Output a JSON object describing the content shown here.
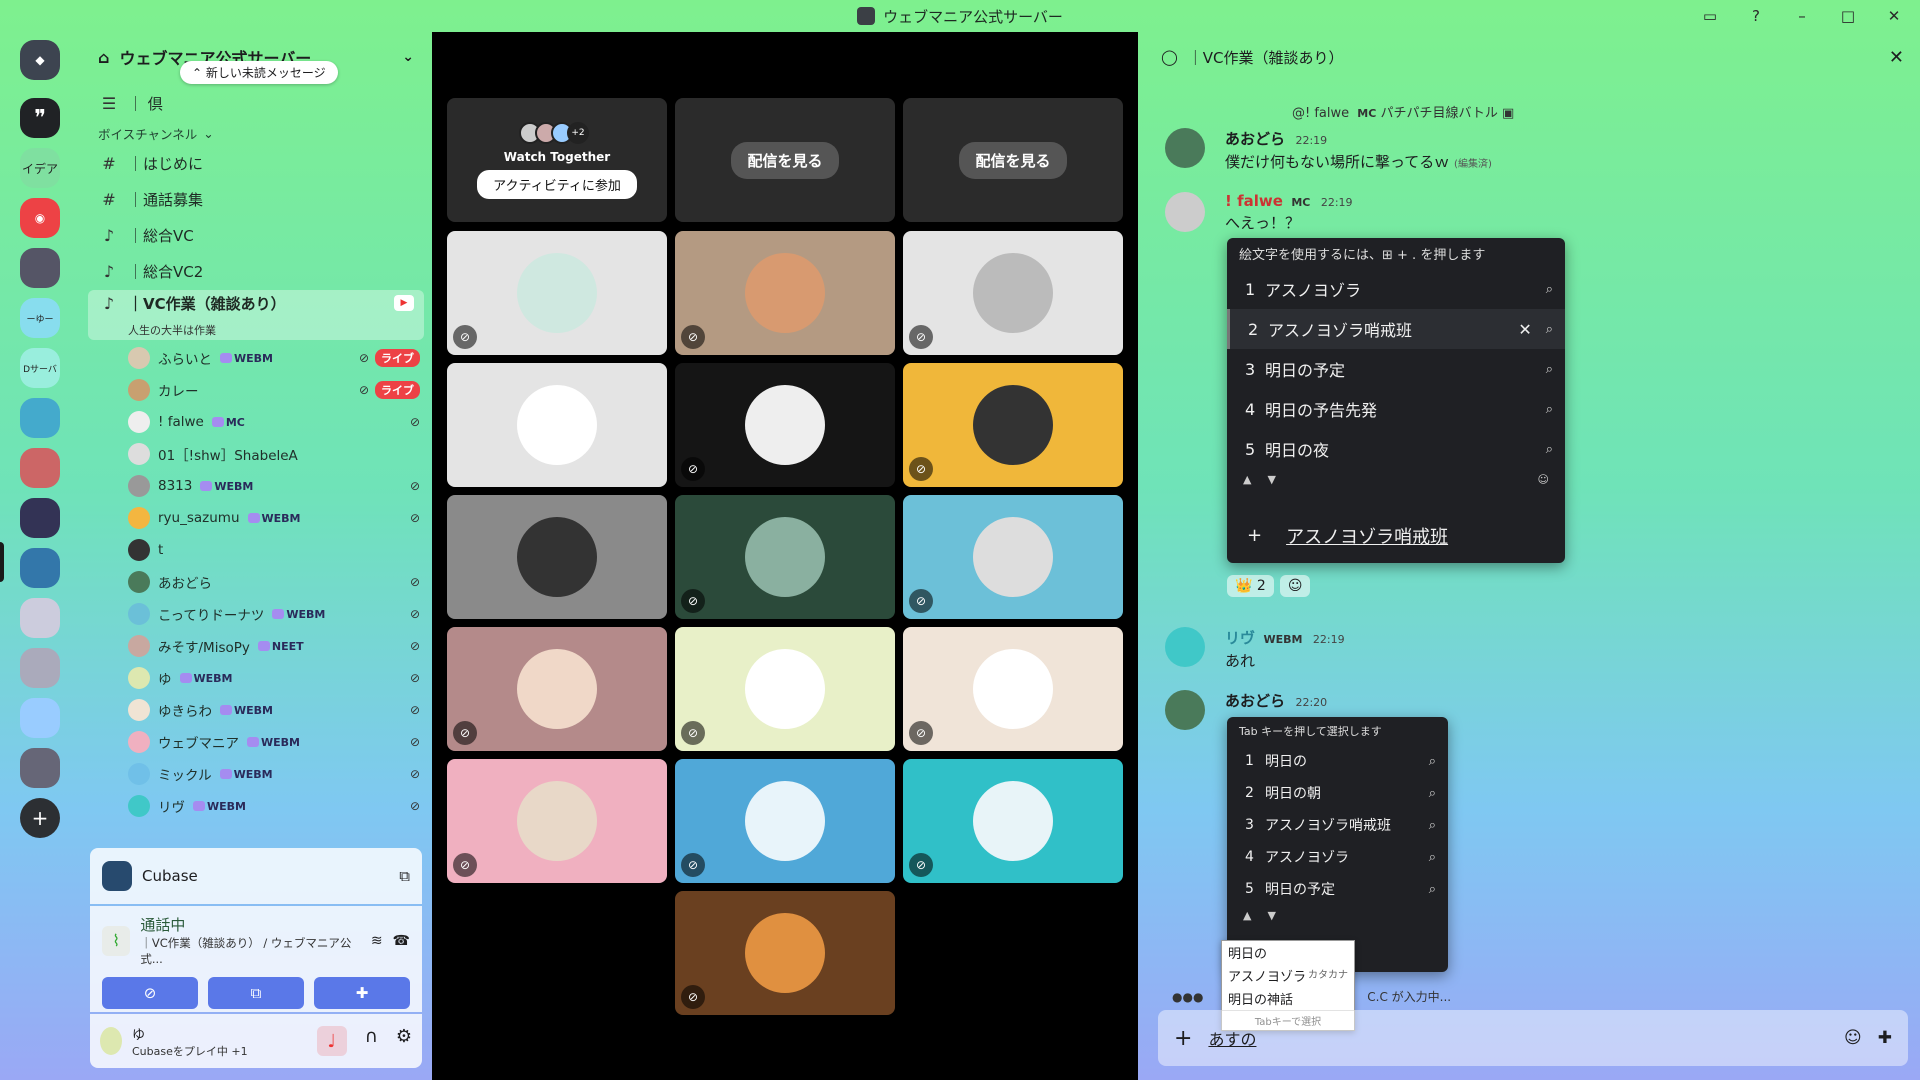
{
  "window": {
    "title": "ウェブマニア公式サーバー"
  },
  "server": {
    "name": "ウェブマニア公式サーバー"
  },
  "sidebar": {
    "unread_pill": "新しい未読メッセージ",
    "category": "ボイスチャンネル",
    "channels": [
      {
        "label": "｜はじめに",
        "icon": "#"
      },
      {
        "label": "｜通話募集",
        "icon": "#"
      },
      {
        "label": "｜総合VC",
        "icon": "🔊"
      },
      {
        "label": "｜総合VC2",
        "icon": "🔊"
      }
    ],
    "active_channel": {
      "label": "｜VC作業（雑談あり）",
      "topic": "人生の大半は作業"
    },
    "voice_users": [
      {
        "name": "ふらいと",
        "tag": "WEBM",
        "live": "ライブ",
        "color": "#d8c9b0"
      },
      {
        "name": "カレー",
        "tag": "",
        "live": "ライブ",
        "color": "#c8a070"
      },
      {
        "name": "! falwe",
        "tag": "MC",
        "live": "",
        "color": "#eee"
      },
      {
        "name": "01［!shw］ShabeleA",
        "tag": "",
        "live": "",
        "color": "#ddd"
      },
      {
        "name": "8313",
        "tag": "WEBM",
        "live": "",
        "color": "#999"
      },
      {
        "name": "ryu_sazumu",
        "tag": "WEBM",
        "live": "",
        "color": "#f3b640"
      },
      {
        "name": "t",
        "tag": "",
        "live": "",
        "color": "#333"
      },
      {
        "name": "あおどら",
        "tag": "",
        "live": "",
        "color": "#4a7a5a"
      },
      {
        "name": "こってりドーナツ",
        "tag": "WEBM",
        "live": "",
        "color": "#6bc0d8"
      },
      {
        "name": "みそす/MisoPy",
        "tag": "NEET",
        "live": "",
        "color": "#c8a8a0"
      },
      {
        "name": "ゆ",
        "tag": "WEBM",
        "live": "",
        "color": "#dde8b0"
      },
      {
        "name": "ゆきらわ",
        "tag": "WEBM",
        "live": "",
        "color": "#f0e4d4"
      },
      {
        "name": "ウェブマニア",
        "tag": "WEBM",
        "live": "",
        "color": "#f0b0c0"
      },
      {
        "name": "ミックル",
        "tag": "WEBM",
        "live": "",
        "color": "#70c0e8"
      },
      {
        "name": "リヴ",
        "tag": "WEBM",
        "live": "",
        "color": "#40c8c8"
      }
    ]
  },
  "activity": {
    "app": "Cubase"
  },
  "voice_status": {
    "state": "通話中",
    "location": "｜VC作業（雑談あり） / ウェブマニア公式..."
  },
  "user": {
    "name": "ゆ",
    "status": "Cubaseをプレイ中 +1"
  },
  "videos": {
    "watch_together": "Watch Together",
    "watch_more": "+2",
    "join_activity": "アクティビティに参加",
    "watch_stream": "配信を見る",
    "watch_stream2": "配信を見る"
  },
  "chat": {
    "channel": "｜VC作業（雑談あり）",
    "reply_preview": "@! falwe",
    "reply_role": "MC",
    "reply_text": "パチパチ目線バトル",
    "messages": [
      {
        "author": "あおどら",
        "time": "22:19",
        "text": "僕だけ何もない場所に撃ってるｗ",
        "edited": "(編集済)"
      },
      {
        "author": "! falwe",
        "role": "MC",
        "time": "22:19",
        "text": "へえっ！？"
      },
      {
        "author": "リヴ",
        "role": "WEBM",
        "time": "22:19",
        "text": "あれ"
      },
      {
        "author": "あおどら",
        "time": "22:20"
      }
    ],
    "reaction_count": "2",
    "typing": "C.C が入力中...",
    "input_value": "あすの"
  },
  "emoji_popup": {
    "hint": "絵文字を使用するには、⊞ + . を押します",
    "items": [
      "アスノヨゾラ",
      "アスノヨゾラ哨戒班",
      "明日の予定",
      "明日の予告先発",
      "明日の夜"
    ],
    "input": "アスノヨゾラ哨戒班"
  },
  "tab_popup": {
    "hint": "Tab キーを押して選択します",
    "items": [
      "明日の",
      "明日の朝",
      "アスノヨゾラ哨戒班",
      "アスノヨゾラ",
      "明日の予定"
    ]
  },
  "ime": {
    "options": [
      {
        "t": "明日の",
        "k": ""
      },
      {
        "t": "アスノヨゾラ",
        "k": "カタカナ"
      },
      {
        "t": "明日の神話",
        "k": ""
      }
    ],
    "footer": "Tabキーで選択"
  }
}
